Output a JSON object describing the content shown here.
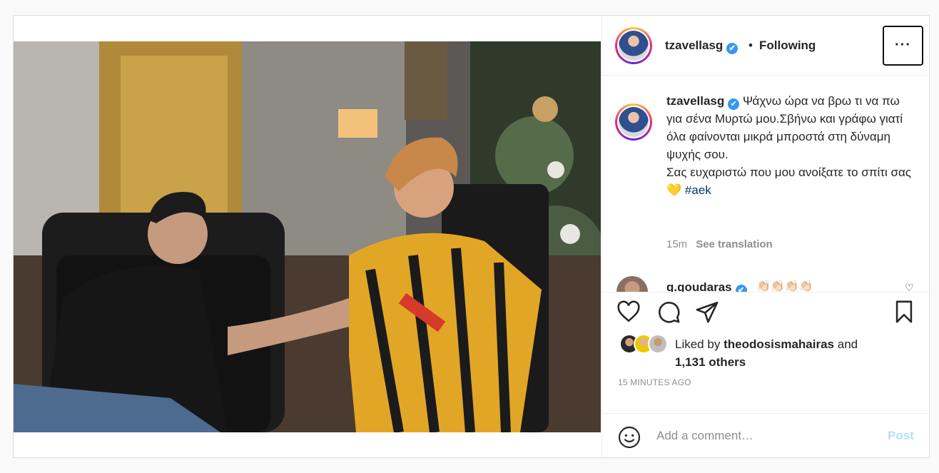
{
  "header": {
    "username": "tzavellasg",
    "verified_mark": "✔",
    "separator": "•",
    "follow_status": "Following",
    "more_label": "···"
  },
  "caption": {
    "username": "tzavellasg",
    "line1": "Ψάχνω ώρα να βρω τι να πω για σένα Μυρτώ μου.Σβήνω και γράφω γιατί όλα φαίνονται μικρά μπροστά στη δύναμη ψυχής σου.",
    "line2": "Σας ευχαριστώ που μου ανοίξατε το σπίτι σας",
    "emoji": "💛",
    "hashtag": "#aek",
    "time": "15m",
    "see_translation": "See translation"
  },
  "comment": {
    "username": "g.goudaras",
    "text": "👏🏻👏🏻👏🏻👏🏻",
    "like_icon": "heart-icon"
  },
  "actions": {
    "icons": [
      "heart-icon",
      "comment-icon",
      "share-icon",
      "bookmark-icon"
    ]
  },
  "likes": {
    "prefix": "Liked by",
    "user": "theodosismahairas",
    "joiner": "and",
    "others": "1,131 others"
  },
  "timestamp": "15 MINUTES AGO",
  "add_comment": {
    "placeholder": "Add a comment…",
    "post_label": "Post",
    "emoji_icon": "smile-icon"
  },
  "colors": {
    "link": "#00376b",
    "verified": "#3897f0",
    "post_disabled": "#b2dffc",
    "meta": "#8e8e8e"
  }
}
